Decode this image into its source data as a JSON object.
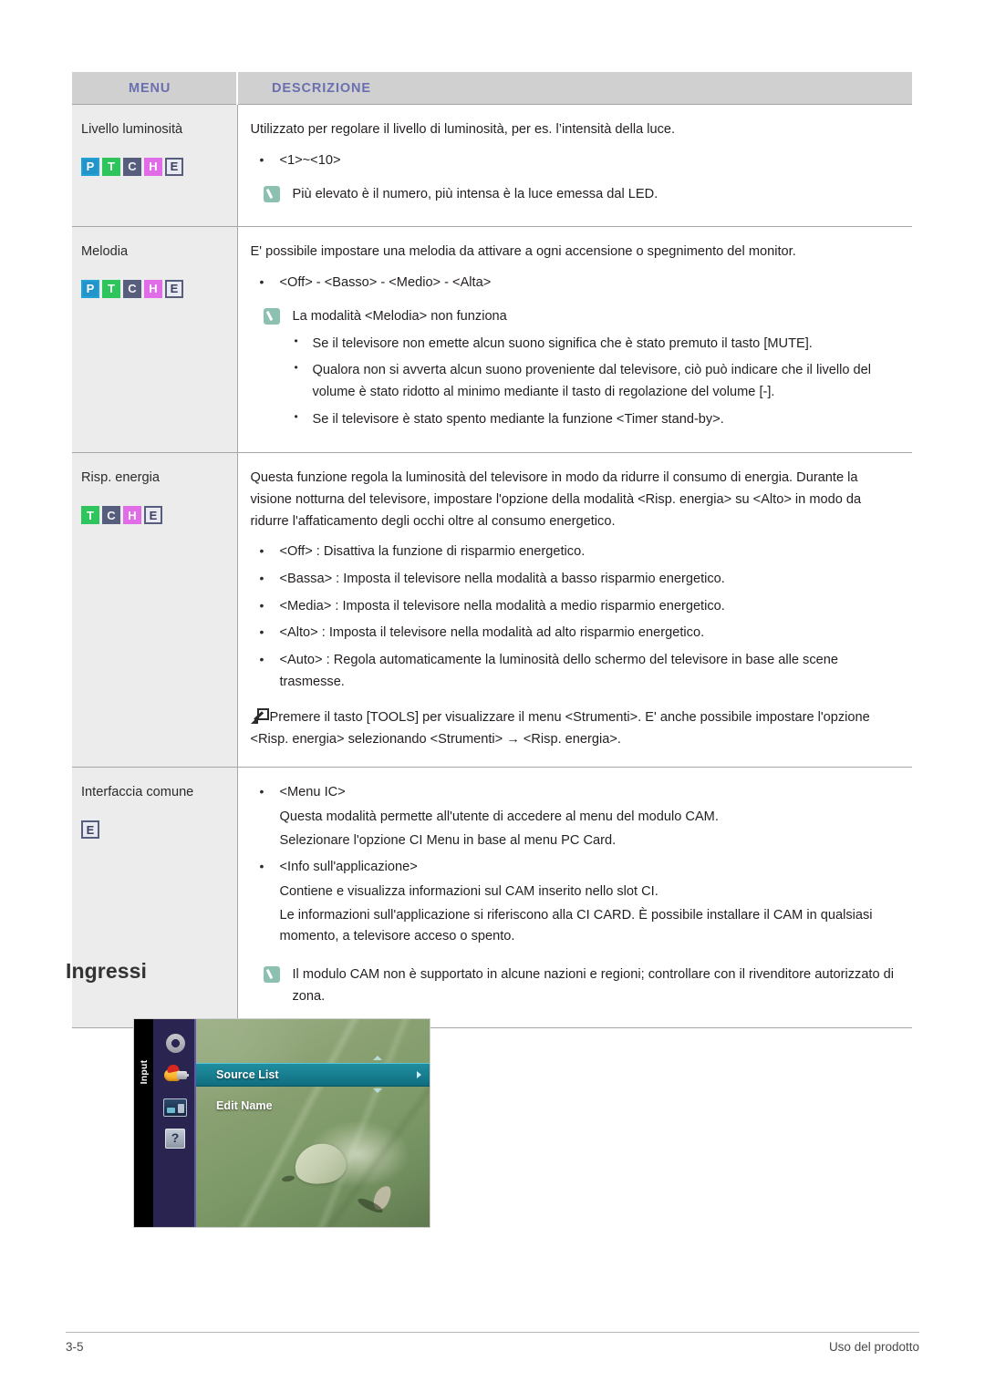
{
  "table": {
    "headers": {
      "menu": "MENU",
      "descrizione": "DESCRIZIONE"
    },
    "header_text_color": "#6a6fb0",
    "header_bg_color": "#d0d0d0",
    "rows": [
      {
        "menu_title": "Livello luminosità",
        "badges": [
          "P",
          "T",
          "C",
          "H",
          "E"
        ],
        "intro": "Utilizzato per regolare il livello di luminosità, per es. l’intensità della luce.",
        "bullets": [
          "<1>~<10>"
        ],
        "note": "Più elevato è il numero, più intensa è la luce emessa dal LED."
      },
      {
        "menu_title": "Melodia",
        "badges": [
          "P",
          "T",
          "C",
          "H",
          "E"
        ],
        "intro": "E' possibile impostare una melodia da attivare a ogni accensione o spegnimento del monitor.",
        "bullets": [
          "<Off> - <Basso> - <Medio> - <Alta>"
        ],
        "note": "La modalità <Melodia> non funziona",
        "note_bullets": [
          "Se il televisore non emette alcun suono significa che è stato premuto il tasto [MUTE].",
          "Qualora non si avverta alcun suono proveniente dal televisore, ciò può indicare che il livello del volume è stato ridotto al minimo mediante il tasto di regolazione del volume [-].",
          "Se il televisore è stato spento mediante la funzione <Timer stand-by>."
        ]
      },
      {
        "menu_title": "Risp. energia",
        "badges": [
          "T",
          "C",
          "H",
          "E"
        ],
        "intro": "Questa funzione regola la luminosità del televisore in modo da ridurre il consumo di energia. Durante la visione notturna del televisore, impostare l'opzione della modalità <Risp. energia> su <Alto> in modo da ridurre l'affaticamento degli occhi oltre al consumo energetico.",
        "bullets": [
          "<Off> : Disattiva la funzione di risparmio energetico.",
          "<Bassa> : Imposta il televisore nella modalità a basso risparmio energetico.",
          "<Media> : Imposta il televisore nella modalità a medio risparmio energetico.",
          "<Alto> : Imposta il televisore nella modalità ad alto risparmio energetico.",
          "<Auto> : Regola automaticamente la luminosità dello schermo del televisore in base alle scene trasmesse."
        ],
        "tools_text": "Premere il tasto [TOOLS] per visualizzare il menu <Strumenti>. E' anche possibile impostare l'opzione <Risp. energia> selezionando <Strumenti> → <Risp. energia>."
      },
      {
        "menu_title": "Interfaccia comune",
        "badges": [
          "E"
        ],
        "bullets_blocks": [
          {
            "bullet": "<Menu IC>",
            "lines": [
              "Questa modalità permette all'utente di accedere al menu del modulo CAM.",
              "Selezionare l'opzione CI Menu in base al menu PC Card."
            ]
          },
          {
            "bullet": "<Info sull'applicazione>",
            "lines": [
              "Contiene e visualizza informazioni sul CAM inserito nello slot CI.",
              "Le informazioni sull'applicazione si riferiscono alla CI CARD. È possibile installare il CAM in qualsiasi momento, a televisore acceso o spento."
            ]
          }
        ],
        "note": "Il modulo CAM non è supportato in alcune nazioni e regioni; controllare con il rivenditore autorizzato di zona."
      }
    ]
  },
  "section": {
    "heading": "Ingressi"
  },
  "osd": {
    "sidebar_label": "Input",
    "icons": [
      "gear-icon",
      "input-plug-icon",
      "picture-icon",
      "help-icon"
    ],
    "items": [
      {
        "label": "Source List",
        "selected": true
      },
      {
        "label": "Edit Name",
        "selected": false
      }
    ],
    "highlight_color": "#167c8d",
    "nav_bg_color": "#2a2450"
  },
  "footer": {
    "page_number": "3-5",
    "section_name": "Uso del prodotto"
  }
}
